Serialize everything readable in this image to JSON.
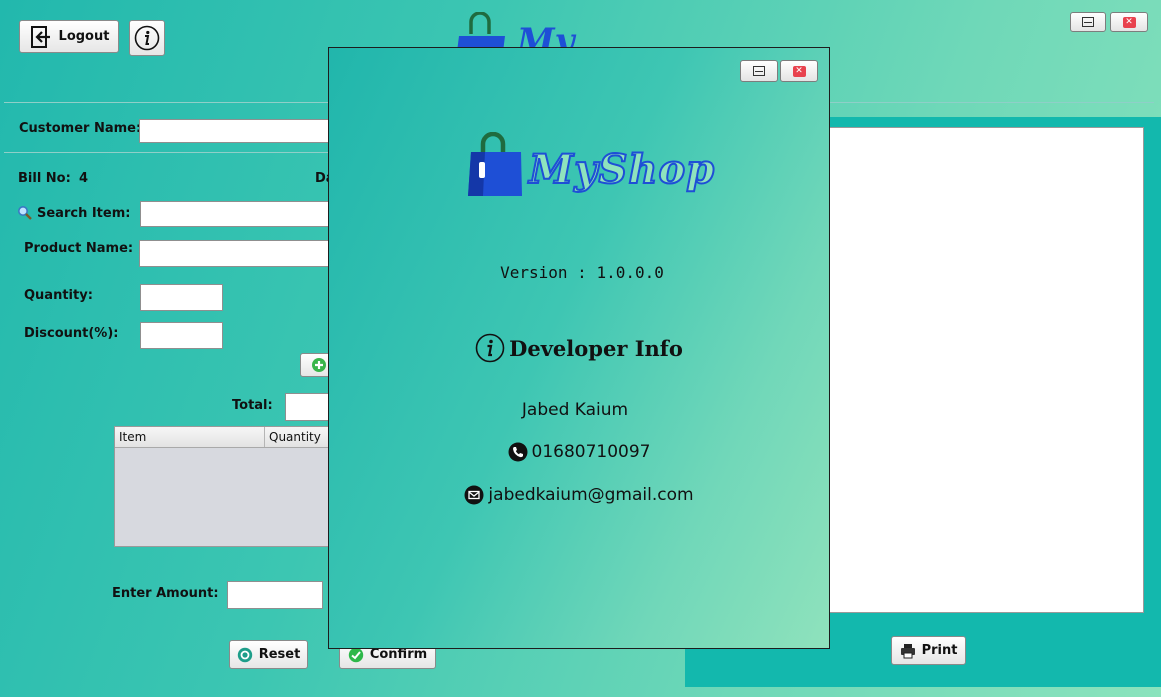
{
  "header": {
    "logout_label": "Logout",
    "info_icon": "info-icon"
  },
  "form": {
    "customer_name_label": "Customer Name:",
    "bill_no_label": "Bill No:",
    "bill_no_value": "4",
    "date_label_partial": "Da",
    "search_label": "Search Item:",
    "product_name_label": "Product Name:",
    "quantity_label": "Quantity:",
    "discount_label": "Discount(%):",
    "total_label": "Total:",
    "enter_amount_label": "Enter Amount:"
  },
  "table": {
    "columns": [
      "Item",
      "Quantity"
    ]
  },
  "buttons": {
    "reset_label": "Reset",
    "confirm_label": "Confirm",
    "print_label": "Print"
  },
  "dialog": {
    "logo_text": "MyShop",
    "version_text": "Version : 1.0.0.0",
    "developer_heading": "Developer Info",
    "developer_name": "Jabed Kaium",
    "phone": "01680710097",
    "email": "jabedkaium@gmail.com"
  },
  "colors": {
    "accent": "#13b8ad",
    "logo_blue": "#1e4fd6",
    "logo_handle": "#1f6b3f"
  }
}
